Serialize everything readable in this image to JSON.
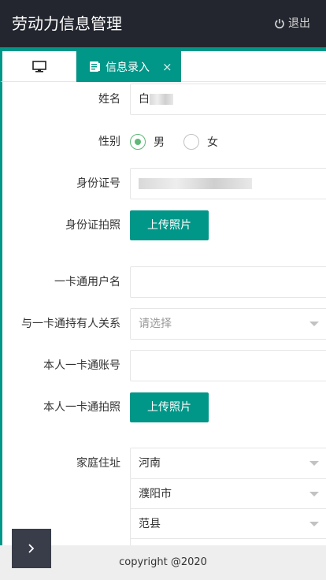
{
  "header": {
    "title": "劳动力信息管理",
    "logout_label": "退出"
  },
  "tabs": {
    "active_label": "信息录入",
    "close_glyph": "×"
  },
  "form": {
    "name": {
      "label": "姓名",
      "value_prefix": "白"
    },
    "gender": {
      "label": "性别",
      "options": [
        "男",
        "女"
      ],
      "selected": "男"
    },
    "id_number": {
      "label": "身份证号"
    },
    "id_photo": {
      "label": "身份证拍照",
      "button": "上传照片"
    },
    "card_username": {
      "label": "一卡通用户名",
      "value": ""
    },
    "card_relation": {
      "label": "与一卡通持有人关系",
      "placeholder": "请选择"
    },
    "card_account": {
      "label": "本人一卡通账号",
      "value": ""
    },
    "card_photo": {
      "label": "本人一卡通拍照",
      "button": "上传照片"
    },
    "address": {
      "label": "家庭住址",
      "province": "河南",
      "city": "濮阳市",
      "county": "范县"
    }
  },
  "footer": {
    "copyright": "copyright @2020"
  },
  "colors": {
    "header_bg": "#23262e",
    "accent": "#009688",
    "radio_checked": "#5fb878",
    "footer_bg": "#eeeeee",
    "float_btn": "#393d49"
  },
  "icons": [
    "power-icon",
    "monitor-icon",
    "document-icon",
    "chevron-right-icon",
    "dropdown-arrow-icon"
  ]
}
